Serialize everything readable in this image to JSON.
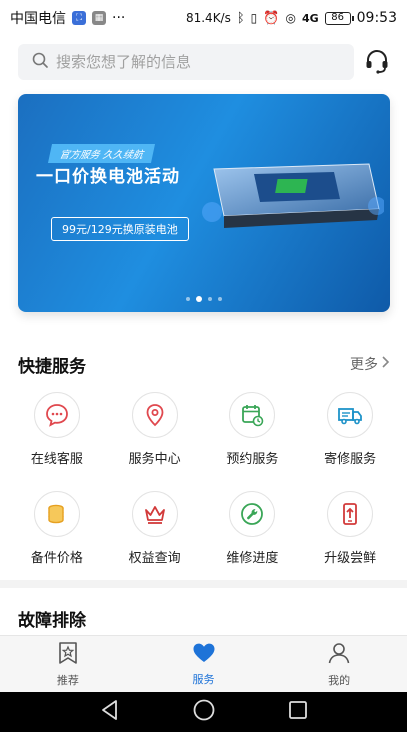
{
  "status_bar": {
    "carrier": "中国电信",
    "speed": "81.4K/s",
    "network": "4G",
    "battery": "86",
    "time": "09:53"
  },
  "search": {
    "placeholder": "搜索您想了解的信息"
  },
  "banner": {
    "tag": "官方服务  久久续航",
    "title": "一口价换电池活动",
    "pill": "99元/129元换原装电池",
    "dots": 4,
    "active_dot": 1
  },
  "quick_services": {
    "title": "快捷服务",
    "more": "更多",
    "items": [
      {
        "label": "在线客服",
        "icon": "chat-icon",
        "color": "#e0484e"
      },
      {
        "label": "服务中心",
        "icon": "location-pin-icon",
        "color": "#e0484e"
      },
      {
        "label": "预约服务",
        "icon": "calendar-icon",
        "color": "#3aa657"
      },
      {
        "label": "寄修服务",
        "icon": "truck-icon",
        "color": "#1f93c9"
      },
      {
        "label": "备件价格",
        "icon": "coins-icon",
        "color": "#e6a020"
      },
      {
        "label": "权益查询",
        "icon": "crown-icon",
        "color": "#d23a3a"
      },
      {
        "label": "维修进度",
        "icon": "wrench-icon",
        "color": "#3aa657"
      },
      {
        "label": "升级尝鲜",
        "icon": "phone-upgrade-icon",
        "color": "#d23a3a"
      }
    ]
  },
  "fault_section": {
    "title": "故障排除"
  },
  "tabbar": {
    "items": [
      {
        "label": "推荐",
        "icon": "bookmark-star-icon",
        "active": false
      },
      {
        "label": "服务",
        "icon": "heart-icon",
        "active": true
      },
      {
        "label": "我的",
        "icon": "person-icon",
        "active": false
      }
    ]
  },
  "colors": {
    "accent": "#1e73d8",
    "banner": "#1b6fc0"
  }
}
